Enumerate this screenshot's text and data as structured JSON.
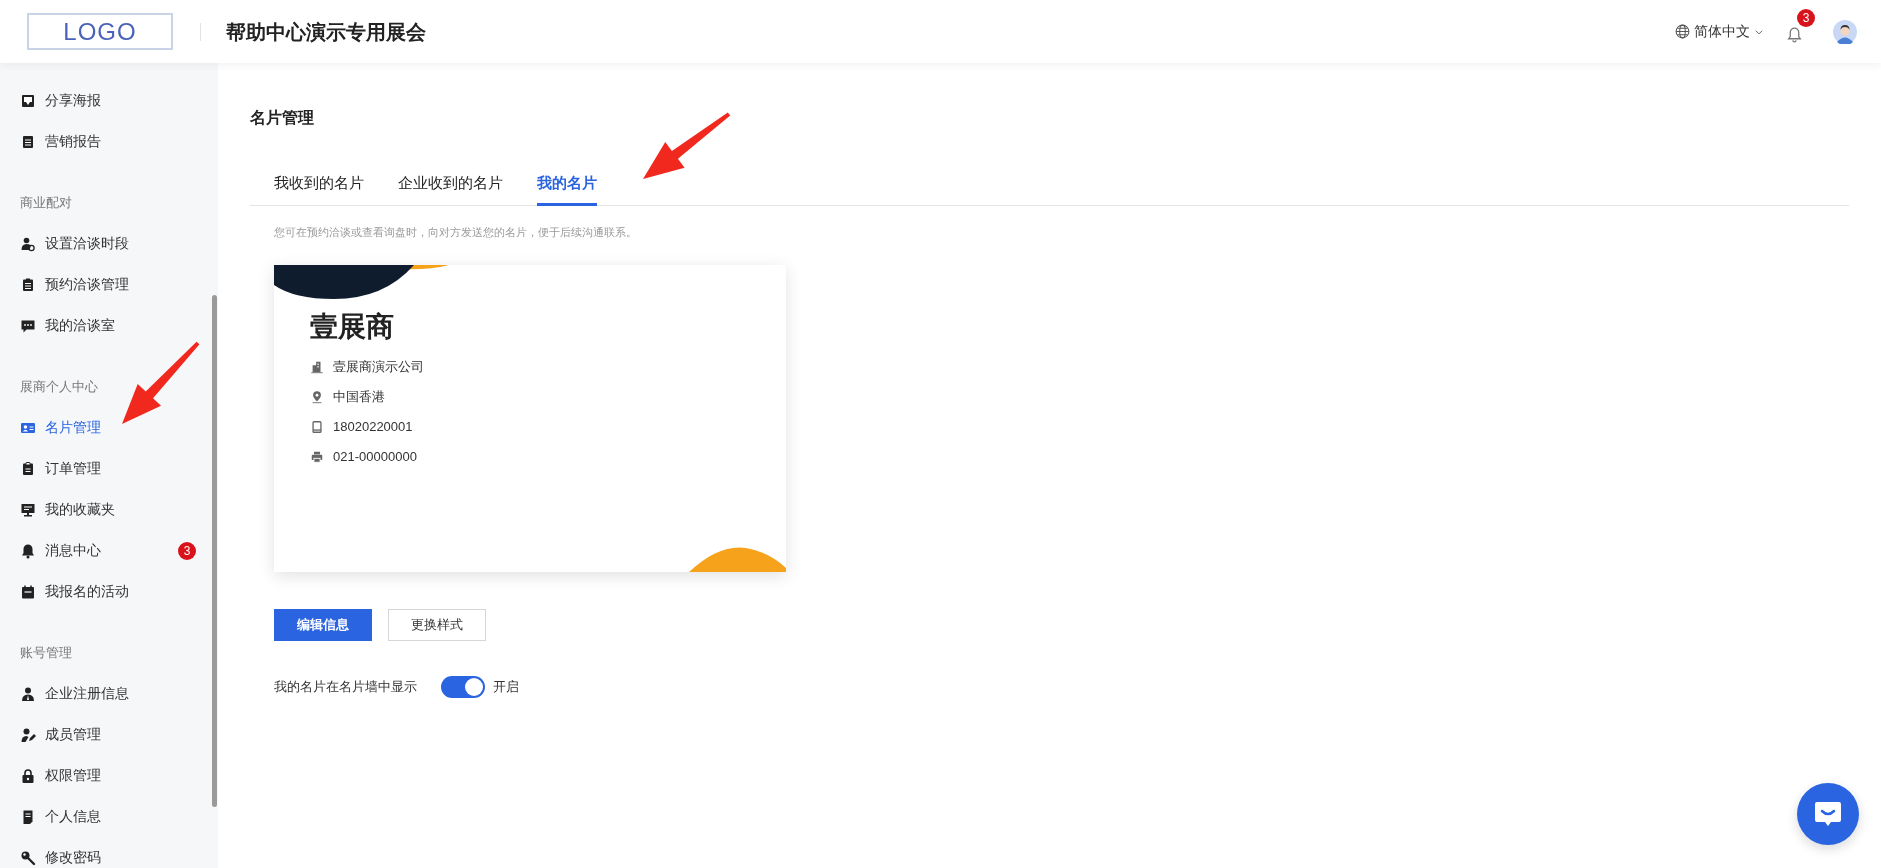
{
  "header": {
    "logo": "LOGO",
    "title": "帮助中心演示专用展会",
    "language": "简体中文",
    "notification_count": "3"
  },
  "sidebar": {
    "sections": [
      {
        "items": [
          {
            "label": "分享海报",
            "selected": false
          },
          {
            "label": "营销报告",
            "selected": false
          }
        ]
      },
      {
        "title": "商业配对",
        "items": [
          {
            "label": "设置洽谈时段",
            "selected": false
          },
          {
            "label": "预约洽谈管理",
            "selected": false
          },
          {
            "label": "我的洽谈室",
            "selected": false
          }
        ]
      },
      {
        "title": "展商个人中心",
        "items": [
          {
            "label": "名片管理",
            "selected": true
          },
          {
            "label": "订单管理",
            "selected": false
          },
          {
            "label": "我的收藏夹",
            "selected": false
          },
          {
            "label": "消息中心",
            "selected": false,
            "badge": "3"
          },
          {
            "label": "我报名的活动",
            "selected": false
          }
        ]
      },
      {
        "title": "账号管理",
        "items": [
          {
            "label": "企业注册信息",
            "selected": false
          },
          {
            "label": "成员管理",
            "selected": false
          },
          {
            "label": "权限管理",
            "selected": false
          },
          {
            "label": "个人信息",
            "selected": false
          },
          {
            "label": "修改密码",
            "selected": false
          }
        ]
      }
    ]
  },
  "page_title": "名片管理",
  "tabs": [
    {
      "label": "我收到的名片",
      "selected": false
    },
    {
      "label": "企业收到的名片",
      "selected": false
    },
    {
      "label": "我的名片",
      "selected": true
    }
  ],
  "hint": "您可在预约洽谈或查看询盘时，向对方发送您的名片，便于后续沟通联系。",
  "card": {
    "name": "壹展商",
    "rows": [
      "壹展商演示公司",
      "中国香港",
      "18020220001",
      "021-00000000"
    ]
  },
  "buttons": [
    {
      "label": "编辑信息",
      "kind": "primary"
    },
    {
      "label": "更换样式",
      "kind": "secondary"
    }
  ],
  "setting": {
    "label": "我的名片在名片墙中显示",
    "on": true,
    "state_text": "开启"
  }
}
